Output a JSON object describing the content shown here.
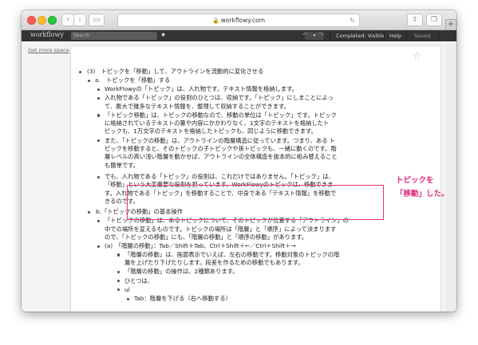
{
  "browser": {
    "url": "workflowy.com",
    "back": "‹",
    "forward": "›",
    "new_tab": "+"
  },
  "workflowy_bar": {
    "logo": "workflowy",
    "search_placeholder": "Search",
    "star": "★",
    "completed": "Completed: Visible",
    "help": "Help",
    "saved": "Saved",
    "dropdown_icon": "▾",
    "undo": "↶",
    "redo": "↷"
  },
  "sidebar": {
    "get_more_space": "Get more space"
  },
  "outline": {
    "root": "(3)　トピックを「移動」して、アウトラインを流動的に変化させる",
    "a_title": "a.　トピックを「移動」する",
    "a_items": [
      [
        "WorkFlowyの「トピック」は、入れ物です。テキスト情報を格納します。"
      ],
      [
        "入れ物である「トピック」の役割のひとつは、収納です。「トピック」にしまことによっ",
        "て、膨大で雑多なテキスト情報を、整理して収納することができます。"
      ],
      [
        "「トピック移動」は、トピックの移動なので、移動の単位は「トピック」です。トピック",
        "に格納されているテキストの量や内容にかかわりなく、1文字のテキストを格納したト",
        "ピックも、1万文字のテキストを格納したトピックも、同じように移動できます。"
      ],
      [
        "また、「トピックの移動」は、アウトラインの階層構造に従っています。つまり、ある ト",
        "ピックを移動すると、そのトピックの子トピックや孫トピックも、一緒に動くのです。階",
        "層レベルの高い浅い階層を動かせば、アウトラインの全体構造を抜本的に組み替えること",
        "も簡単です。"
      ],
      [
        "でも、入れ物である「トピック」の役割は、これだけではありません。「トピック」は、",
        "「移動」という大変重要な役割を担っています。WorkFlowyのトピックは、移動できま",
        "す。入れ物である「トピック」を移動することで、中身である「テキスト情報」を移動で",
        "きるのです。"
      ]
    ],
    "b_title": "b.「トピックの移動」の基本操作",
    "b_items": [
      [
        "「トピックの移動」は、あるトピックについて、そのトピックが位置する「アウトライン」の",
        "中での場所を変えるものです。トピックの場所は「階層」と「順序」によって決まります",
        "ので、「トピックの移動」にも、「階層の移動」と「順序の移動」があります。"
      ]
    ],
    "c_title": "(a)　「階層の移動」：Tab／Shift＋Tab、Ctrl＋Shift＋←／Ctrl＋Shift＋→",
    "c_items": [
      [
        "「階層の移動」は、画面表示でいえば、左右の移動です。移動対象のトピックの階",
        "層を上げたり下げたりします。段差を作るための移動でもあります。"
      ],
      [
        "「階層の移動」の操作は、2種類あります。"
      ],
      [
        "ひとつは、"
      ],
      [
        "ul"
      ]
    ],
    "d_items": [
      "Tab：階層を下げる（右へ移動する）"
    ]
  },
  "annotation": {
    "callout": [
      "トピックを",
      "「移動」した。"
    ]
  }
}
